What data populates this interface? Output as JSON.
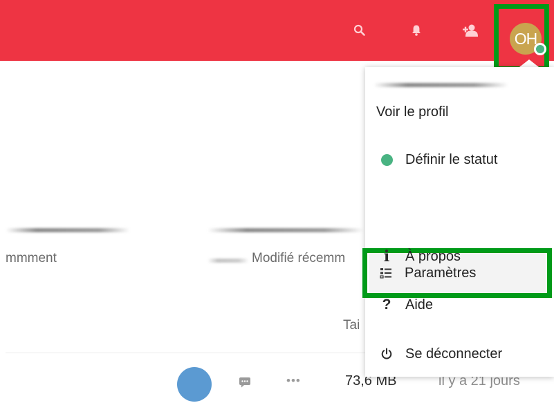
{
  "header": {
    "icons": [
      "search-icon",
      "bell-icon",
      "contacts-icon"
    ],
    "avatar_initials": "OH",
    "colors": {
      "bar": "#ee3443",
      "avatar": "#c9a44f",
      "status": "#49b382",
      "highlight": "#009a18"
    }
  },
  "files": {
    "col_left_text": "mmment",
    "col_modified_text": "Modifié récemm",
    "size_header_partial": "Tai",
    "row": {
      "size": "73,6 MB",
      "modified": "il y a 21 jours"
    }
  },
  "menu": {
    "items": [
      {
        "label": "Voir le profil",
        "icon": ""
      },
      {
        "label": "Définir le statut",
        "icon": "status-dot"
      },
      {
        "label": "Paramètres",
        "icon": "settings-list-icon"
      },
      {
        "label": "À propos",
        "icon": "info-icon",
        "glyph": "i"
      },
      {
        "label": "Aide",
        "icon": "help-icon",
        "glyph": "?"
      },
      {
        "label": "Se déconnecter",
        "icon": "power-icon"
      }
    ]
  }
}
